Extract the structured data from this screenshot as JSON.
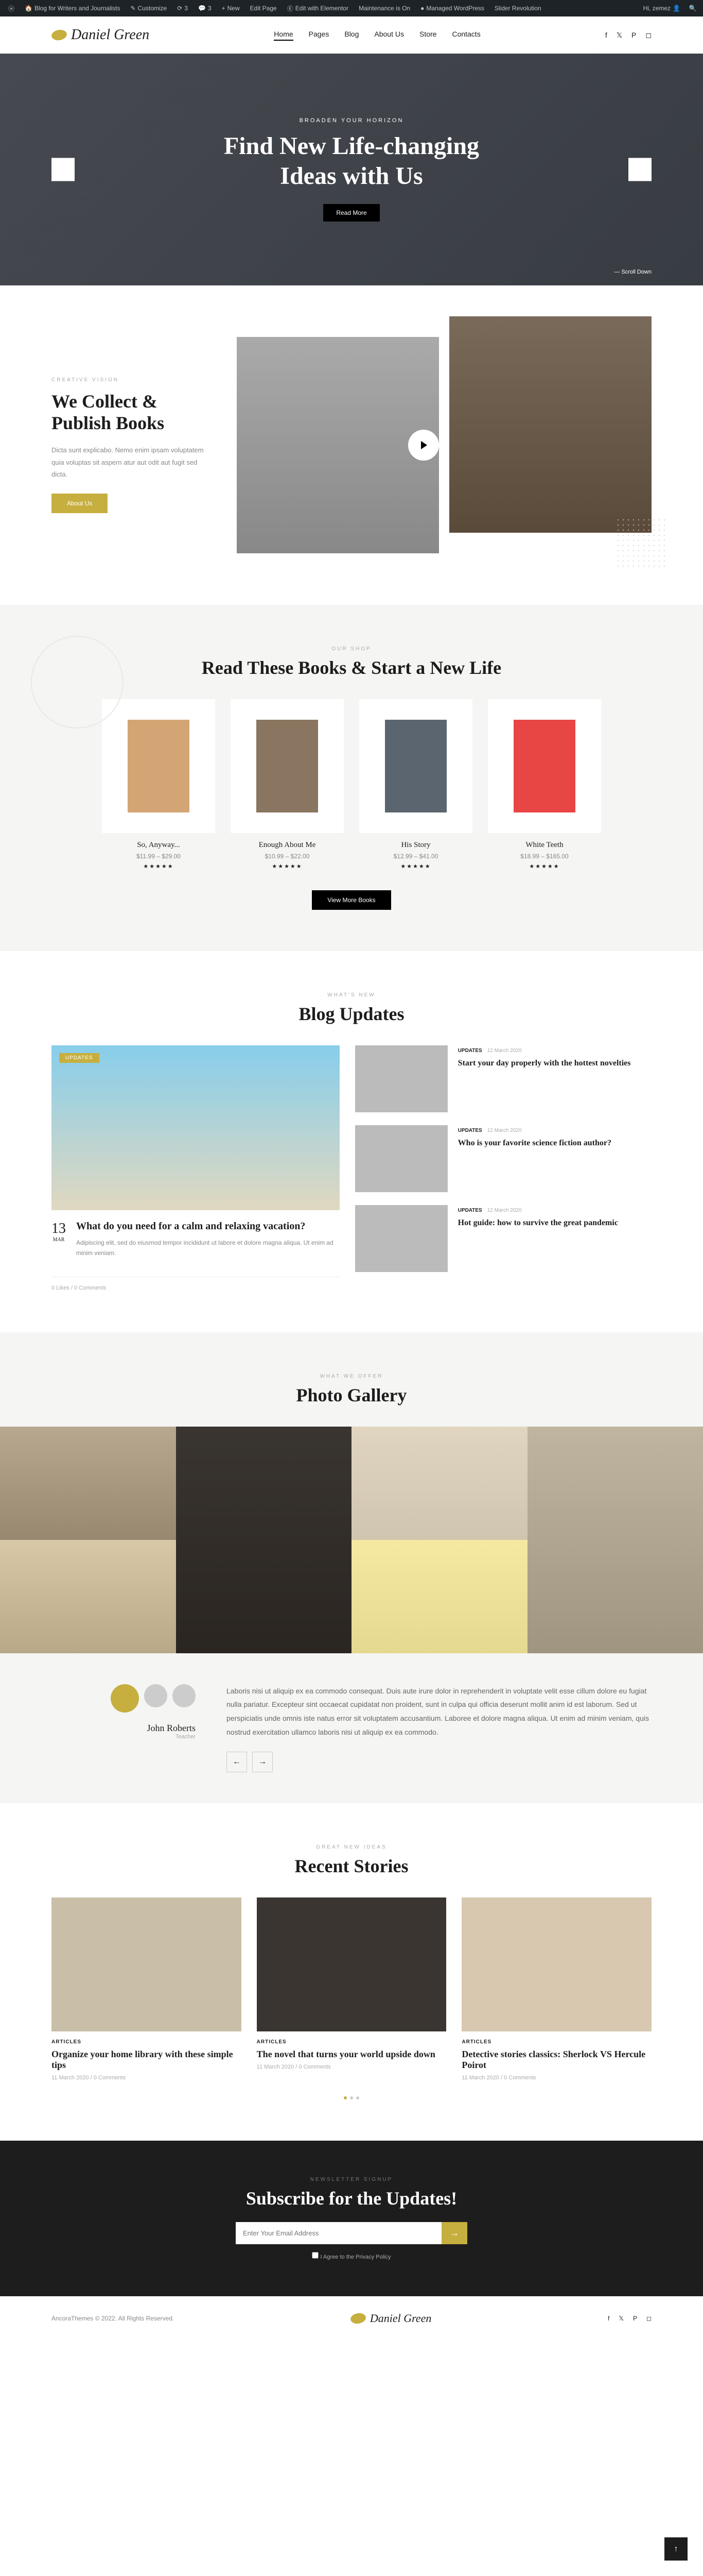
{
  "admin": {
    "items": [
      "Blog for Writers and Journalists",
      "Customize",
      "3",
      "3",
      "New",
      "Edit Page",
      "Edit with Elementor",
      "Maintenance is On",
      "Managed WordPress",
      "Slider Revolution"
    ],
    "greeting": "Hi, zemez"
  },
  "logo": "Daniel Green",
  "nav": [
    "Home",
    "Pages",
    "Blog",
    "About Us",
    "Store",
    "Contacts"
  ],
  "hero": {
    "sub": "BROADEN YOUR HORIZON",
    "title": "Find New Life-changing Ideas with Us",
    "btn": "Read More",
    "scroll": "Scroll Down"
  },
  "collect": {
    "sub": "CREATIVE VISION",
    "title": "We Collect & Publish Books",
    "desc": "Dicta sunt explicabo. Nemo enim ipsam voluptatem quia voluptas sit aspern atur aut odit aut fugit sed dicta.",
    "btn": "About Us"
  },
  "shop": {
    "sub": "OUR SHOP",
    "title": "Read These Books & Start a New Life",
    "books": [
      {
        "name": "So, Anyway...",
        "price": "$11.99 – $29.00",
        "cover": "#d4a574"
      },
      {
        "name": "Enough About Me",
        "price": "$10.99 – $22.00",
        "cover": "#8a7560"
      },
      {
        "name": "His Story",
        "price": "$12.99 – $41.00",
        "cover": "#5a6570"
      },
      {
        "name": "White Teeth",
        "price": "$18.99 – $165.00",
        "cover": "#e84545"
      }
    ],
    "btn": "View More Books"
  },
  "blog": {
    "sub": "WHAT'S NEW",
    "title": "Blog Updates",
    "main": {
      "badge": "UPDATES",
      "date_num": "13",
      "date_mon": "MAR",
      "title": "What do you need for a calm and relaxing vacation?",
      "desc": "Adipiscing elit, sed do eiusmod tempor incididunt ut labore et dolore magna aliqua. Ut enim ad minim veniam.",
      "meta": "0 Likes  /  0 Comments"
    },
    "side": [
      {
        "cat": "UPDATES",
        "date": "12 March 2020",
        "title": "Start your day properly with the hottest novelties"
      },
      {
        "cat": "UPDATES",
        "date": "12 March 2020",
        "title": "Who is your favorite science fiction author?"
      },
      {
        "cat": "UPDATES",
        "date": "12 March 2020",
        "title": "Hot guide: how to survive the great pandemic"
      }
    ]
  },
  "gallery": {
    "sub": "WHAT WE OFFER",
    "title": "Photo Gallery"
  },
  "testimonial": {
    "name": "John Roberts",
    "role": "Teacher",
    "text": "Laboris nisi ut aliquip ex ea commodo consequat. Duis aute irure dolor in reprehenderit in voluptate velit esse cillum dolore eu fugiat nulla pariatur. Excepteur sint occaecat cupidatat non proident, sunt in culpa qui officia deserunt mollit anim id est laborum. Sed ut perspiciatis unde omnis iste natus error sit voluptatem accusantium.\n\nLaboree et dolore magna aliqua. Ut enim ad minim veniam, quis nostrud exercitation ullamco laboris nisi ut aliquip ex ea commodo."
  },
  "stories": {
    "sub": "GREAT NEW IDEAS",
    "title": "Recent Stories",
    "items": [
      {
        "cat": "ARTICLES",
        "title": "Organize your home library with these simple tips",
        "meta": "11 March 2020  /  0 Comments",
        "bg": "#c9bfa8"
      },
      {
        "cat": "ARTICLES",
        "title": "The novel that turns your world upside down",
        "meta": "11 March 2020  /  0 Comments",
        "bg": "#3a3530"
      },
      {
        "cat": "ARTICLES",
        "title": "Detective stories classics: Sherlock VS Hercule Poirot",
        "meta": "11 March 2020  /  0 Comments",
        "bg": "#d8c8b0"
      }
    ]
  },
  "newsletter": {
    "sub": "NEWSLETTER SIGNUP",
    "title": "Subscribe for the Updates!",
    "placeholder": "Enter Your Email Address",
    "agree": "I Agree to the Privacy Policy"
  },
  "footer": {
    "copy": "AncoraThemes © 2022. All Rights Reserved."
  }
}
